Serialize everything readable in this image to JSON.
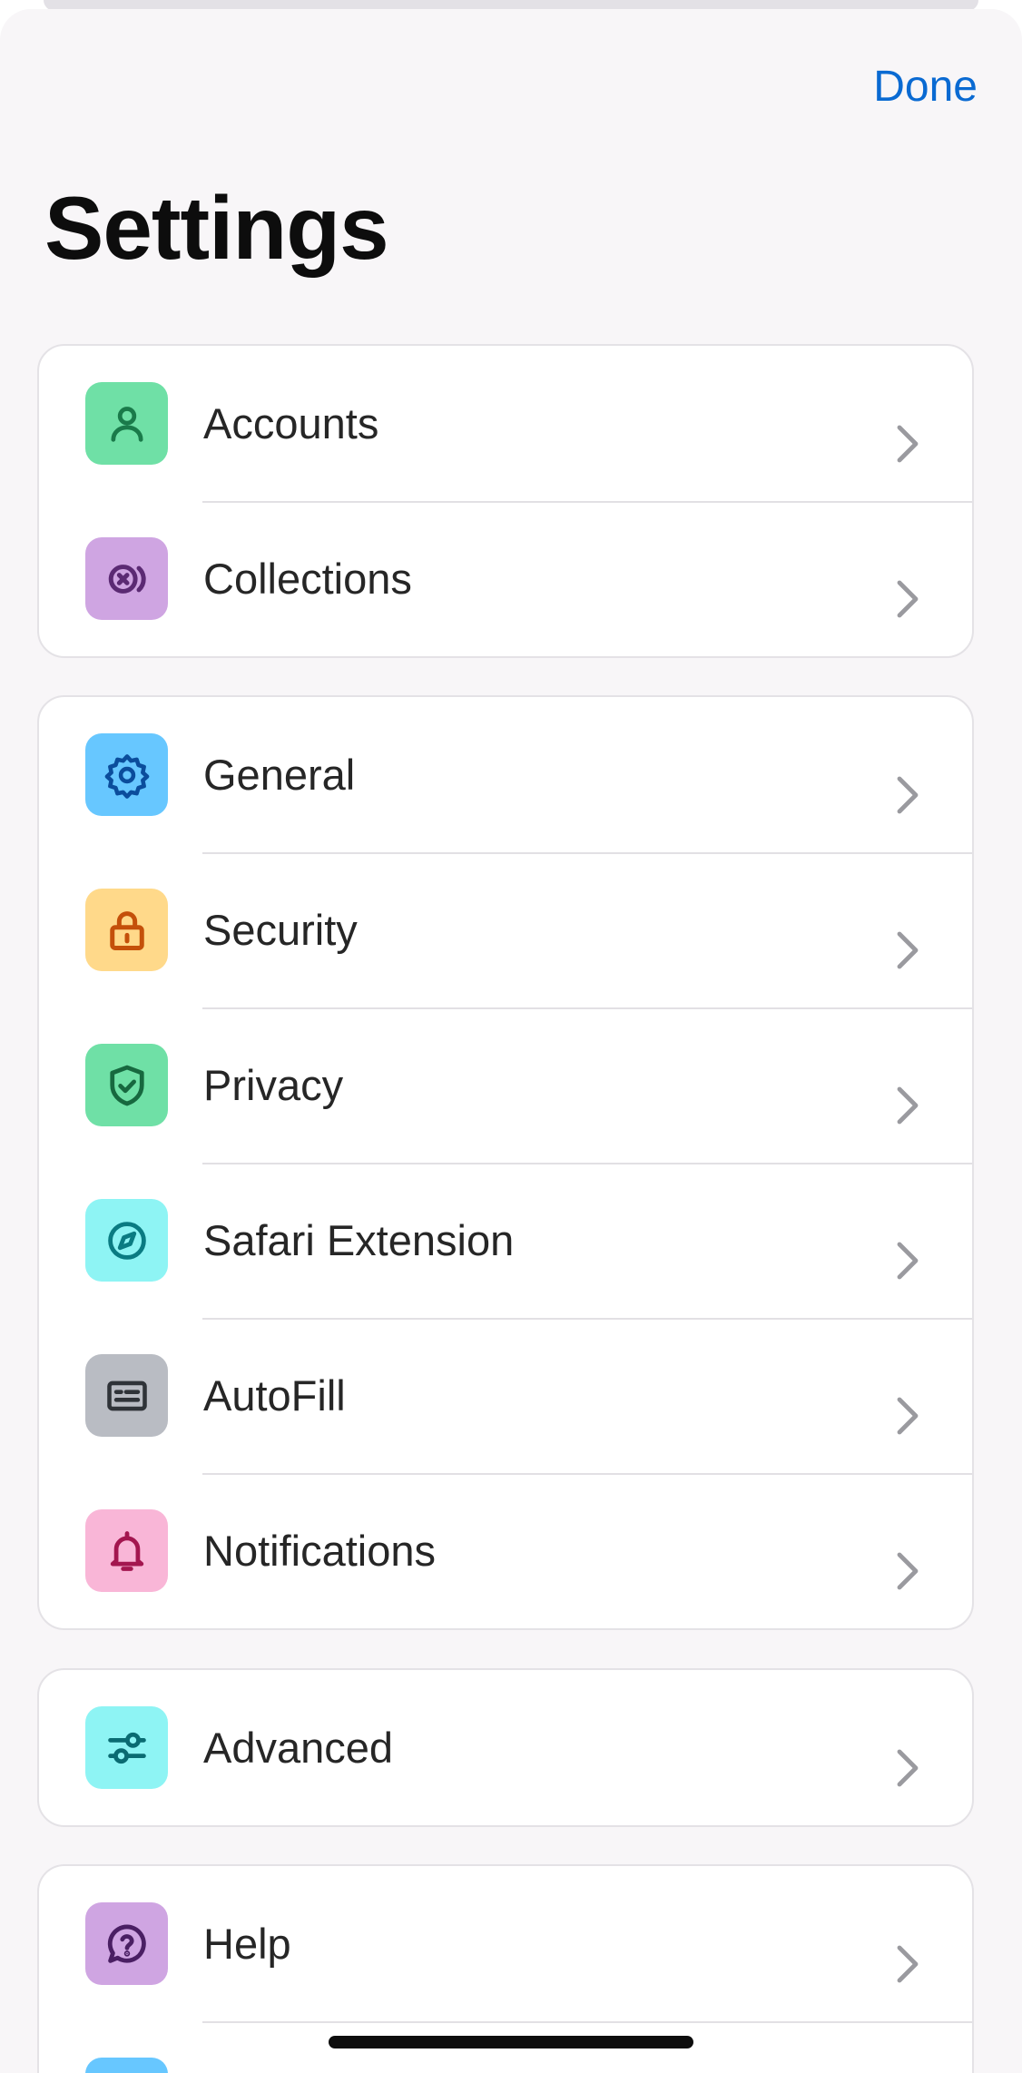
{
  "header": {
    "done_label": "Done",
    "title": "Settings"
  },
  "colors": {
    "accent": "#0a6ad2",
    "background": "#f8f6f8",
    "card": "#ffffff"
  },
  "groups": [
    {
      "items": [
        {
          "label": "Accounts",
          "icon": "person-icon",
          "tile": "#6fe0a6",
          "fg": "#1a7a4a"
        },
        {
          "label": "Collections",
          "icon": "collection-icon",
          "tile": "#cfa5e2",
          "fg": "#5b2a73"
        }
      ]
    },
    {
      "items": [
        {
          "label": "General",
          "icon": "gear-icon",
          "tile": "#67c7ff",
          "fg": "#0b4d9c"
        },
        {
          "label": "Security",
          "icon": "lock-icon",
          "tile": "#ffd98a",
          "fg": "#c4500a"
        },
        {
          "label": "Privacy",
          "icon": "shield-check-icon",
          "tile": "#6fe0a6",
          "fg": "#17683f"
        },
        {
          "label": "Safari Extension",
          "icon": "compass-icon",
          "tile": "#8ef4f4",
          "fg": "#0a7b82"
        },
        {
          "label": "AutoFill",
          "icon": "card-icon",
          "tile": "#b9bcc3",
          "fg": "#2f3338"
        },
        {
          "label": "Notifications",
          "icon": "bell-icon",
          "tile": "#f9b6d7",
          "fg": "#a3164f"
        }
      ]
    },
    {
      "items": [
        {
          "label": "Advanced",
          "icon": "sliders-icon",
          "tile": "#8ef4f4",
          "fg": "#0a6b72"
        }
      ]
    },
    {
      "items": [
        {
          "label": "Help",
          "icon": "help-icon",
          "tile": "#cfa5e2",
          "fg": "#4a1f63"
        },
        {
          "label": "",
          "icon": "partial-icon",
          "tile": "#67c7ff",
          "fg": "#0b4d9c"
        }
      ]
    }
  ]
}
